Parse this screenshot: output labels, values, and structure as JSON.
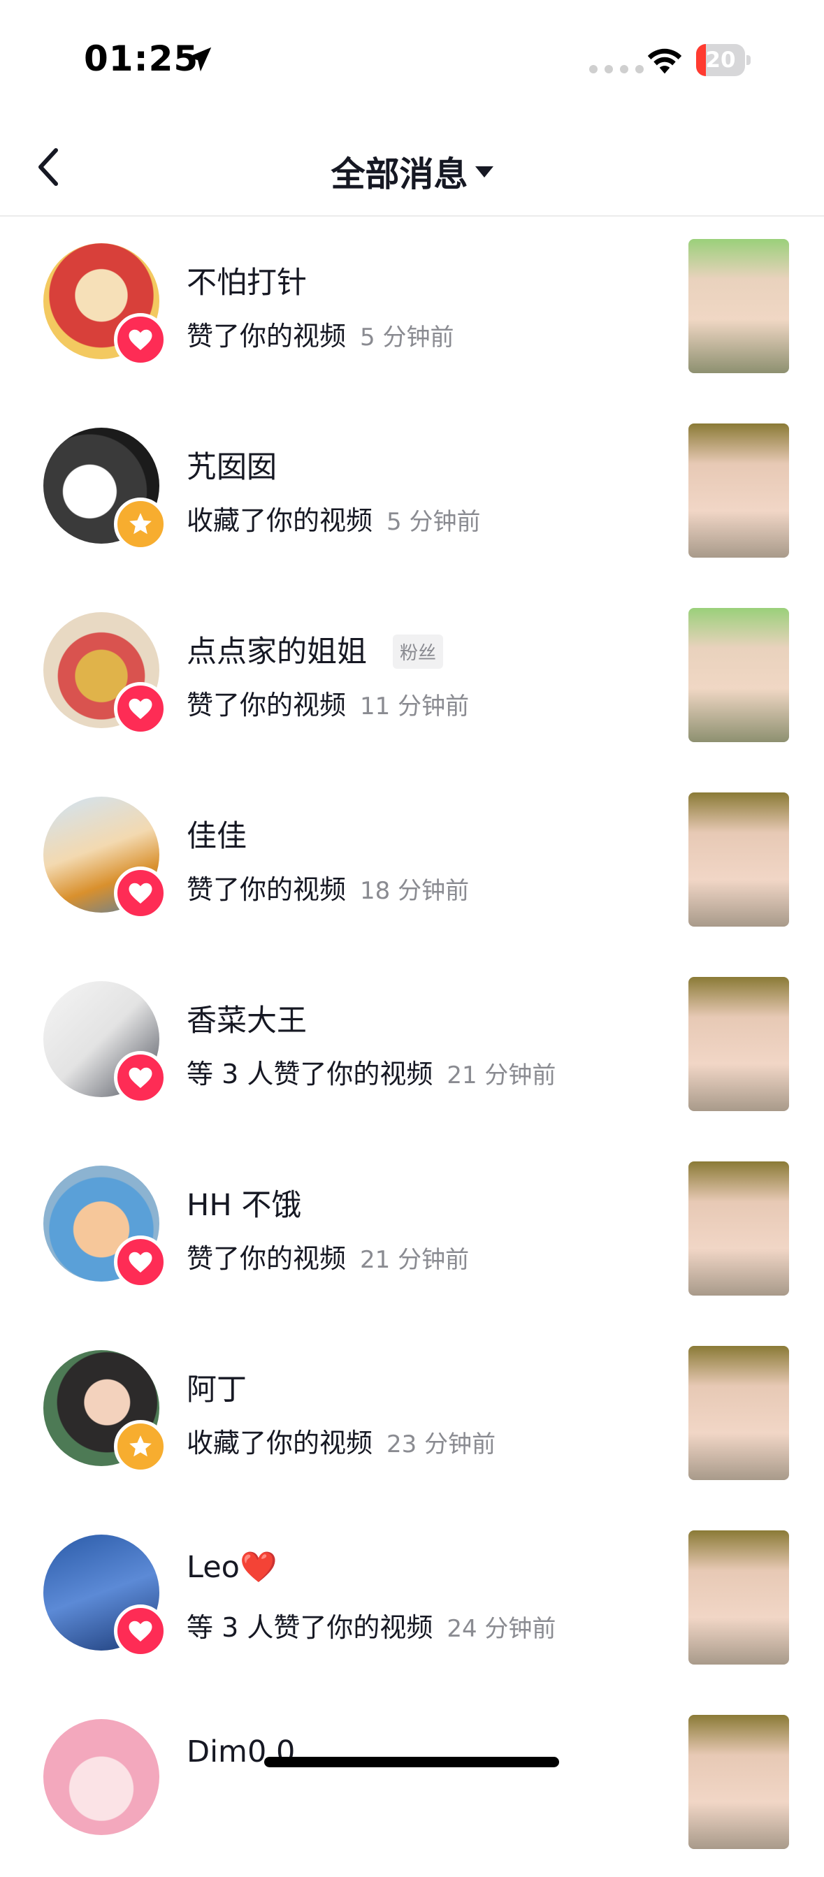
{
  "status_bar": {
    "time": "01:25",
    "battery": "20",
    "battery_level": 0.2
  },
  "header": {
    "title": "全部消息"
  },
  "messages": [
    {
      "name": "不怕打针",
      "tag": "",
      "action": "赞了你的视频",
      "time": "5 分钟前",
      "badge": "heart"
    },
    {
      "name": "艽囡囡",
      "tag": "",
      "action": "收藏了你的视频",
      "time": "5 分钟前",
      "badge": "star"
    },
    {
      "name": "点点家的姐姐",
      "tag": "粉丝",
      "action": "赞了你的视频",
      "time": "11 分钟前",
      "badge": "heart"
    },
    {
      "name": "佳佳",
      "tag": "",
      "action": "赞了你的视频",
      "time": "18 分钟前",
      "badge": "heart"
    },
    {
      "name": "香菜大王",
      "tag": "",
      "action": "等 3 人赞了你的视频",
      "time": "21 分钟前",
      "badge": "heart"
    },
    {
      "name": "HH 不饿",
      "tag": "",
      "action": "赞了你的视频",
      "time": "21 分钟前",
      "badge": "heart"
    },
    {
      "name": "阿丁",
      "tag": "",
      "action": "收藏了你的视频",
      "time": "23 分钟前",
      "badge": "star"
    },
    {
      "name": "Leo❤️",
      "tag": "",
      "action": "等 3 人赞了你的视频",
      "time": "24 分钟前",
      "badge": "heart"
    },
    {
      "name": "Dim0.0",
      "tag": "",
      "action": "",
      "time": "",
      "badge": ""
    }
  ],
  "colors": {
    "like": "#fe2c55",
    "favorite": "#f7ad2f",
    "text": "#161823",
    "muted": "#8a8b91"
  }
}
